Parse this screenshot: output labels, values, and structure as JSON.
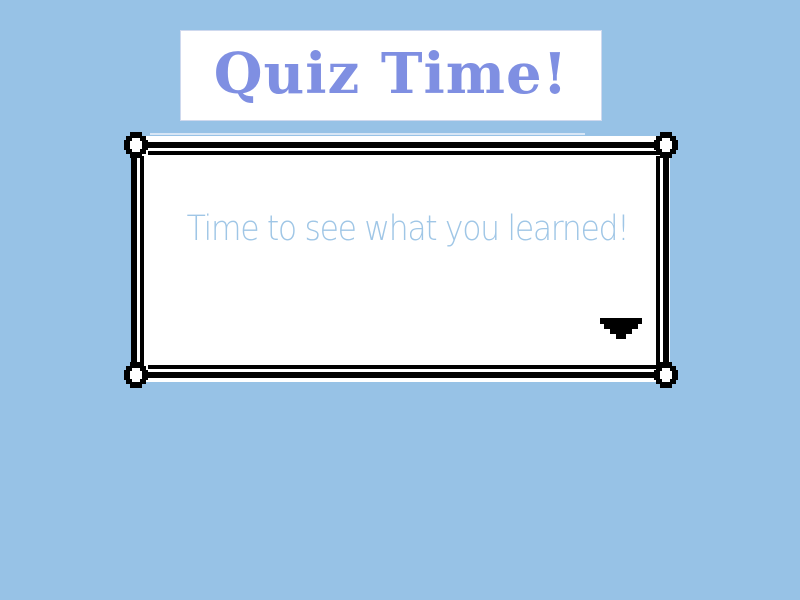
{
  "title": "Quiz Time!",
  "dialog": {
    "message": "Time to see what you learned!",
    "advance_icon": "down-triangle-icon"
  },
  "colors": {
    "background": "#97c2e6",
    "title_text": "#7f8fe2",
    "message_text": "#9fc6e6",
    "frame": "#000000",
    "panel": "#ffffff"
  }
}
